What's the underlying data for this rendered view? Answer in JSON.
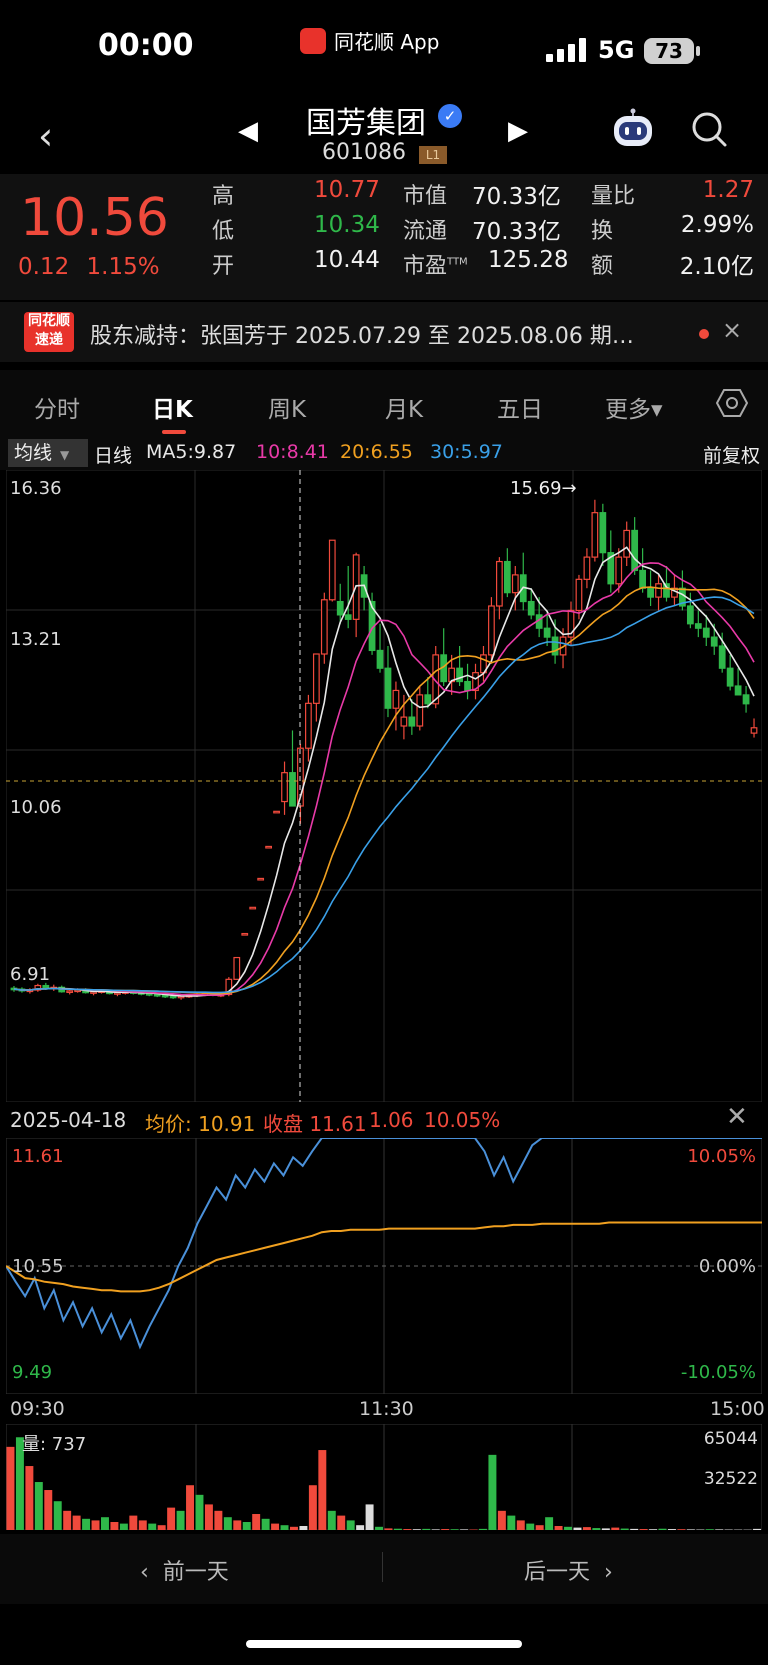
{
  "status": {
    "time": "00:00",
    "app": "同花顺 App",
    "network": "5G",
    "battery": "73"
  },
  "header": {
    "back_icon": "chevron-left-icon",
    "stock_name": "国芳集团",
    "code": "601086",
    "level": "L1"
  },
  "quote": {
    "price": "10.56",
    "change": "0.12",
    "change_pct": "1.15%",
    "high_label": "高",
    "high": "10.77",
    "low_label": "低",
    "low": "10.34",
    "open_label": "开",
    "open": "10.44",
    "mktcap_label": "市值",
    "mktcap": "70.33亿",
    "float_label": "流通",
    "float": "70.33亿",
    "pe_label": "市盈",
    "pe_sup": "TTM",
    "pe": "125.28",
    "volratio_label": "量比",
    "volratio": "1.27",
    "turnover_label": "换",
    "turnover": "2.99%",
    "amount_label": "额",
    "amount": "2.10亿"
  },
  "news": {
    "logo_line1": "同花顺",
    "logo_line2": "速递",
    "text": "股东减持：张国芳于 2025.07.29 至 2025.08.06 期…",
    "close": "×"
  },
  "tabs": [
    {
      "label": "分时"
    },
    {
      "label": "日K"
    },
    {
      "label": "周K"
    },
    {
      "label": "月K"
    },
    {
      "label": "五日"
    },
    {
      "label": "更多▾"
    }
  ],
  "ma": {
    "selector": "均线",
    "line": "日线",
    "ma5": "MA5:9.87",
    "ma10": "10:8.41",
    "ma20": "20:6.55",
    "ma30": "30:5.97",
    "adjust": "前复权",
    "colors": {
      "ma5": "#e8e8e8",
      "ma10": "#e83aa8",
      "ma20": "#f0a020",
      "ma30": "#3aa0e8"
    }
  },
  "kline": {
    "y_labels": [
      "16.36",
      "13.21",
      "10.06",
      "6.91"
    ],
    "peak_label": "15.69→"
  },
  "chart_data": [
    {
      "type": "candlestick",
      "ylim": [
        3.76,
        16.36
      ],
      "candles": [
        [
          4.7,
          4.75,
          4.62,
          4.68
        ],
        [
          4.68,
          4.72,
          4.6,
          4.64
        ],
        [
          4.64,
          4.7,
          4.58,
          4.66
        ],
        [
          4.66,
          4.8,
          4.62,
          4.76
        ],
        [
          4.76,
          4.82,
          4.66,
          4.7
        ],
        [
          4.7,
          4.78,
          4.64,
          4.72
        ],
        [
          4.72,
          4.76,
          4.6,
          4.62
        ],
        [
          4.62,
          4.68,
          4.56,
          4.64
        ],
        [
          4.64,
          4.7,
          4.6,
          4.66
        ],
        [
          4.66,
          4.7,
          4.58,
          4.6
        ],
        [
          4.6,
          4.66,
          4.54,
          4.62
        ],
        [
          4.62,
          4.68,
          4.58,
          4.64
        ],
        [
          4.64,
          4.66,
          4.56,
          4.58
        ],
        [
          4.58,
          4.64,
          4.52,
          4.6
        ],
        [
          4.6,
          4.66,
          4.56,
          4.62
        ],
        [
          4.62,
          4.66,
          4.56,
          4.6
        ],
        [
          4.6,
          4.64,
          4.54,
          4.58
        ],
        [
          4.58,
          4.62,
          4.52,
          4.56
        ],
        [
          4.56,
          4.6,
          4.5,
          4.54
        ],
        [
          4.54,
          4.58,
          4.48,
          4.52
        ],
        [
          4.52,
          4.56,
          4.46,
          4.5
        ],
        [
          4.5,
          4.54,
          4.44,
          4.52
        ],
        [
          4.52,
          4.56,
          4.48,
          4.54
        ],
        [
          4.54,
          4.58,
          4.5,
          4.56
        ],
        [
          4.56,
          4.6,
          4.52,
          4.58
        ],
        [
          4.58,
          4.6,
          4.52,
          4.54
        ],
        [
          4.54,
          4.58,
          4.5,
          4.56
        ],
        [
          4.56,
          4.95,
          4.52,
          4.9
        ],
        [
          4.9,
          5.4,
          4.9,
          5.39
        ],
        [
          5.93,
          5.93,
          5.93,
          5.93
        ],
        [
          6.52,
          6.52,
          6.52,
          6.52
        ],
        [
          7.17,
          7.17,
          7.17,
          7.17
        ],
        [
          7.89,
          7.89,
          7.89,
          7.89
        ],
        [
          8.68,
          8.68,
          8.68,
          8.68
        ],
        [
          8.9,
          9.8,
          8.6,
          9.55
        ],
        [
          9.55,
          10.5,
          9.2,
          8.8
        ],
        [
          8.8,
          10.2,
          8.4,
          10.1
        ],
        [
          10.1,
          11.3,
          9.8,
          11.11
        ],
        [
          11.11,
          12.2,
          10.7,
          12.22
        ],
        [
          12.22,
          13.6,
          12.0,
          13.44
        ],
        [
          13.44,
          14.78,
          13.4,
          14.78
        ],
        [
          13.4,
          13.8,
          12.9,
          13.1
        ],
        [
          13.1,
          14.2,
          12.8,
          13.0
        ],
        [
          13.0,
          14.5,
          12.6,
          14.45
        ],
        [
          14.0,
          14.2,
          13.2,
          13.5
        ],
        [
          13.4,
          13.6,
          12.2,
          12.3
        ],
        [
          12.3,
          12.9,
          11.8,
          11.9
        ],
        [
          11.9,
          12.4,
          10.8,
          11.0
        ],
        [
          11.0,
          11.6,
          10.5,
          11.4
        ],
        [
          10.6,
          11.3,
          10.3,
          10.8
        ],
        [
          10.8,
          11.2,
          10.4,
          10.6
        ],
        [
          10.6,
          11.5,
          10.5,
          11.3
        ],
        [
          11.3,
          11.7,
          11.0,
          11.1
        ],
        [
          11.1,
          12.4,
          11.0,
          12.2
        ],
        [
          12.2,
          12.8,
          11.5,
          11.6
        ],
        [
          11.6,
          12.2,
          11.3,
          11.9
        ],
        [
          11.9,
          12.4,
          11.5,
          11.6
        ],
        [
          11.6,
          12.0,
          11.2,
          11.4
        ],
        [
          11.4,
          12.0,
          11.2,
          11.8
        ],
        [
          11.8,
          12.4,
          11.6,
          12.2
        ],
        [
          12.2,
          13.5,
          12.0,
          13.3
        ],
        [
          13.3,
          14.4,
          13.0,
          14.3
        ],
        [
          14.3,
          14.6,
          13.5,
          13.6
        ],
        [
          13.6,
          14.2,
          13.2,
          14.0
        ],
        [
          14.0,
          14.5,
          13.2,
          13.4
        ],
        [
          13.4,
          13.7,
          13.0,
          13.1
        ],
        [
          13.1,
          13.5,
          12.6,
          12.8
        ],
        [
          12.8,
          13.2,
          12.4,
          12.6
        ],
        [
          12.6,
          13.0,
          12.0,
          12.2
        ],
        [
          12.2,
          12.8,
          11.9,
          12.6
        ],
        [
          12.6,
          13.4,
          12.4,
          13.2
        ],
        [
          13.2,
          14.0,
          13.0,
          13.9
        ],
        [
          13.9,
          14.6,
          13.7,
          14.4
        ],
        [
          14.4,
          15.69,
          14.3,
          15.4
        ],
        [
          15.4,
          15.6,
          14.2,
          14.5
        ],
        [
          14.5,
          15.0,
          13.6,
          13.8
        ],
        [
          13.8,
          14.6,
          13.6,
          14.4
        ],
        [
          14.4,
          15.2,
          14.2,
          15.0
        ],
        [
          15.0,
          15.3,
          14.0,
          14.1
        ],
        [
          14.1,
          14.6,
          13.6,
          13.7
        ],
        [
          13.7,
          14.1,
          13.3,
          13.5
        ],
        [
          13.5,
          14.0,
          13.2,
          13.8
        ],
        [
          13.8,
          14.2,
          13.4,
          13.5
        ],
        [
          13.5,
          14.0,
          13.3,
          13.7
        ],
        [
          13.7,
          14.1,
          13.2,
          13.3
        ],
        [
          13.3,
          13.6,
          12.8,
          12.9
        ],
        [
          12.9,
          13.2,
          12.6,
          12.8
        ],
        [
          12.8,
          13.1,
          12.4,
          12.6
        ],
        [
          12.6,
          12.9,
          12.2,
          12.4
        ],
        [
          12.4,
          12.7,
          11.8,
          11.9
        ],
        [
          11.9,
          12.2,
          11.4,
          11.5
        ],
        [
          11.5,
          11.9,
          11.3,
          11.3
        ],
        [
          11.3,
          11.5,
          10.9,
          11.1
        ],
        [
          10.44,
          10.77,
          10.34,
          10.56
        ]
      ],
      "candle_format": [
        "open",
        "high",
        "low",
        "close"
      ],
      "ma_final": {
        "ma5": 9.87,
        "ma10": 8.41,
        "ma20": 6.55,
        "ma30": 5.97
      }
    },
    {
      "type": "line",
      "date": "2025-04-18",
      "avg_price": "10.91",
      "close": "11.61",
      "change": "1.06",
      "change_pct": "10.05%",
      "ylim": [
        9.49,
        11.61
      ],
      "base": 10.55,
      "y_labels_left": [
        "11.61",
        "10.55",
        "9.49"
      ],
      "y_labels_right": [
        "10.05%",
        "0.00%",
        "-10.05%"
      ],
      "x_labels": [
        "09:30",
        "11:30",
        "15:00"
      ],
      "price": [
        10.55,
        10.42,
        10.3,
        10.45,
        10.2,
        10.35,
        10.1,
        10.25,
        10.05,
        10.2,
        10.0,
        10.15,
        9.95,
        10.1,
        9.88,
        10.05,
        10.2,
        10.35,
        10.55,
        10.7,
        10.9,
        11.05,
        11.2,
        11.1,
        11.3,
        11.2,
        11.35,
        11.25,
        11.4,
        11.3,
        11.45,
        11.38,
        11.5,
        11.61,
        11.61,
        11.61,
        11.61,
        11.61,
        11.61,
        11.61,
        11.61,
        11.61,
        11.61,
        11.61,
        11.61,
        11.61,
        11.61,
        11.61,
        11.61,
        11.61,
        11.5,
        11.3,
        11.45,
        11.25,
        11.4,
        11.55,
        11.61,
        11.61,
        11.61,
        11.61,
        11.61,
        11.61,
        11.61,
        11.61,
        11.61,
        11.61,
        11.61,
        11.61,
        11.61,
        11.61,
        11.61,
        11.61,
        11.61,
        11.61,
        11.61,
        11.61,
        11.61,
        11.61,
        11.61,
        11.61
      ],
      "avg": [
        10.55,
        10.5,
        10.45,
        10.44,
        10.42,
        10.41,
        10.4,
        10.38,
        10.37,
        10.36,
        10.35,
        10.35,
        10.34,
        10.34,
        10.34,
        10.35,
        10.37,
        10.4,
        10.44,
        10.48,
        10.52,
        10.56,
        10.6,
        10.62,
        10.64,
        10.66,
        10.68,
        10.7,
        10.72,
        10.74,
        10.76,
        10.78,
        10.8,
        10.83,
        10.84,
        10.84,
        10.85,
        10.85,
        10.85,
        10.85,
        10.86,
        10.86,
        10.86,
        10.86,
        10.86,
        10.86,
        10.86,
        10.86,
        10.86,
        10.86,
        10.87,
        10.88,
        10.88,
        10.89,
        10.89,
        10.89,
        10.9,
        10.9,
        10.9,
        10.9,
        10.9,
        10.9,
        10.9,
        10.91,
        10.91,
        10.91,
        10.91,
        10.91,
        10.91,
        10.91,
        10.91,
        10.91,
        10.91,
        10.91,
        10.91,
        10.91,
        10.91,
        10.91,
        10.91,
        10.91
      ],
      "volume_label": "量: 737",
      "volume_ticks": [
        "65044",
        "32522"
      ],
      "volume": [
        52000,
        58000,
        40000,
        30000,
        25000,
        18000,
        12000,
        9000,
        7000,
        6000,
        8000,
        5000,
        4000,
        9000,
        6000,
        4000,
        3000,
        14000,
        12000,
        28000,
        22000,
        16000,
        12000,
        8000,
        6000,
        5000,
        10000,
        7000,
        4000,
        3000,
        2000,
        2500,
        28000,
        50000,
        12000,
        9000,
        6000,
        3000,
        16000,
        2000,
        1000,
        800,
        600,
        500,
        700,
        400,
        600,
        500,
        400,
        300,
        700,
        47000,
        12000,
        9000,
        6000,
        4000,
        3000,
        8000,
        2500,
        2000,
        1500,
        1800,
        1200,
        1000,
        1500,
        900,
        700,
        600,
        500,
        800,
        600,
        500,
        400,
        300,
        500,
        400,
        300,
        250,
        200,
        700
      ],
      "volume_colors": [
        "r",
        "g",
        "r",
        "g",
        "r",
        "g",
        "r",
        "r",
        "g",
        "r",
        "g",
        "r",
        "g",
        "r",
        "r",
        "g",
        "r",
        "r",
        "g",
        "r",
        "g",
        "r",
        "r",
        "g",
        "r",
        "g",
        "r",
        "g",
        "r",
        "g",
        "r",
        "w",
        "r",
        "r",
        "g",
        "r",
        "g",
        "w",
        "w",
        "g",
        "r",
        "g",
        "r",
        "w",
        "g",
        "w",
        "r",
        "g",
        "w",
        "r",
        "g",
        "g",
        "r",
        "g",
        "r",
        "g",
        "r",
        "g",
        "r",
        "g",
        "w",
        "r",
        "g",
        "w",
        "r",
        "g",
        "w",
        "r",
        "w",
        "g",
        "w",
        "r",
        "w",
        "w",
        "g",
        "w",
        "w",
        "w",
        "w",
        "w"
      ]
    }
  ],
  "bottomnav": {
    "prev": "前一天",
    "next": "后一天"
  }
}
